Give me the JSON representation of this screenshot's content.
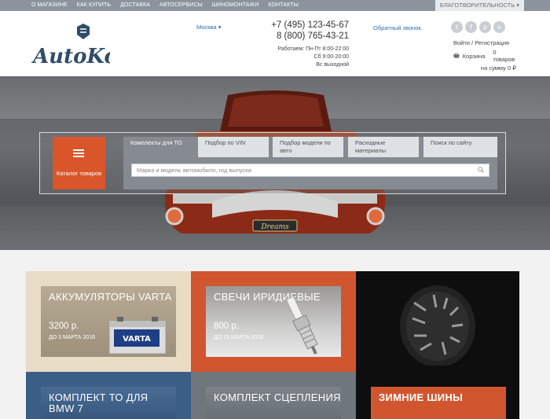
{
  "topnav": {
    "items": [
      "О МАГАЗИНЕ",
      "КАК КУПИТЬ",
      "ДОСТАВКА",
      "АВТОСЕРВИСЫ",
      "ШИНОМОНТАЖИ",
      "КОНТАКТЫ"
    ],
    "charity": "БЛАГОТВОРИТЕЛЬНОСТЬ ▾"
  },
  "header": {
    "logo_text": "AutoKote",
    "city": "Москва ▾",
    "phone1": "+7 (495) 123-45-67",
    "phone2": "8 (800) 765-43-21",
    "hours": [
      "Работаем: Пн-Пт 8:00-22:00",
      "Сб 9:00-20:00",
      "Вс выходной"
    ],
    "callback": "Обратный звонок",
    "login": "Войти / Регистрация",
    "cart_label": "Корзина",
    "cart_count": "0 товаров",
    "cart_sum": "на сумму 0 ₽"
  },
  "hero": {
    "catalog": "Каталог товаров",
    "tabs": [
      {
        "label": "Комплекты для ТО",
        "active": true
      },
      {
        "label": "Подбор по VIN",
        "active": false
      },
      {
        "label": "Подбор модели по авто",
        "active": false
      },
      {
        "label": "Расходные материалы",
        "active": false
      },
      {
        "label": "Поиск по сайту",
        "active": false
      }
    ],
    "search_placeholder": "Марка и модель автомобиля, год выпуска",
    "plate": "Dreams"
  },
  "promos": [
    {
      "title": "АККУМУЛЯТОРЫ VARTA",
      "price": "3200 р.",
      "until": "ДО 3 МАРТА 2016",
      "brand": "VARTA"
    },
    {
      "title": "СВЕЧИ ИРИДИЕВЫЕ",
      "price": "800 р.",
      "until": "ДО 15 МАРТА 2016"
    },
    {
      "title": "КОМПЛЕКТ ТО ДЛЯ BMW 7"
    },
    {
      "title": "КОМПЛЕКТ СЦЕПЛЕНИЯ"
    },
    {
      "title": "ЗИМНИЕ ШИНЫ"
    }
  ],
  "colors": {
    "accent": "#d9562b",
    "link": "#2e6ea6",
    "topbar": "#8b949c",
    "logo": "#2f4c6a"
  }
}
